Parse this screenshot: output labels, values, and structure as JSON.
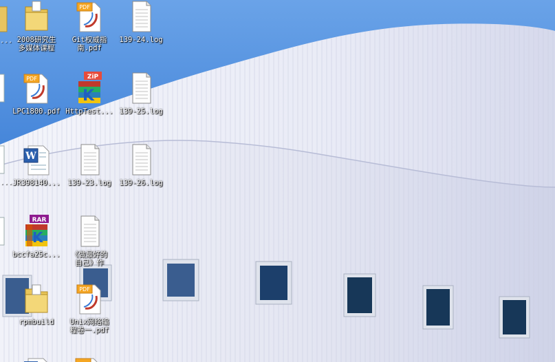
{
  "desktop": {
    "icons": [
      {
        "label": "2008研究生\n多媒体课程",
        "icon": "folder-icon"
      },
      {
        "label": "Git权威指\n南.pdf",
        "icon": "pdf-icon"
      },
      {
        "label": "139-24.log",
        "icon": "text-file-icon"
      },
      {
        "label": "LPC1800.pdf",
        "icon": "pdf-icon"
      },
      {
        "label": "HttpTest...",
        "icon": "zip-archive-icon"
      },
      {
        "label": "139-25.log",
        "icon": "text-file-icon"
      },
      {
        "label": "JR398140...",
        "icon": "word-document-icon"
      },
      {
        "label": "139-23.log",
        "icon": "text-file-icon"
      },
      {
        "label": "139-26.log",
        "icon": "text-file-icon"
      },
      {
        "label": "bccfa25c...",
        "icon": "rar-archive-icon"
      },
      {
        "label": "《做最好的\n自己》作",
        "icon": "text-file-icon"
      },
      {
        "label": "rpmbuild",
        "icon": "folder-icon"
      },
      {
        "label": "Unix网络编\n程卷一.pdf",
        "icon": "pdf-icon"
      }
    ],
    "edge_labels": [
      "...",
      "..."
    ]
  },
  "colors": {
    "sky": "#3d7fd6",
    "building": "#eef0f8",
    "window_frame": "#d8dde6",
    "window_glass": "#1c3f6b",
    "label_text": "#ffffff"
  }
}
